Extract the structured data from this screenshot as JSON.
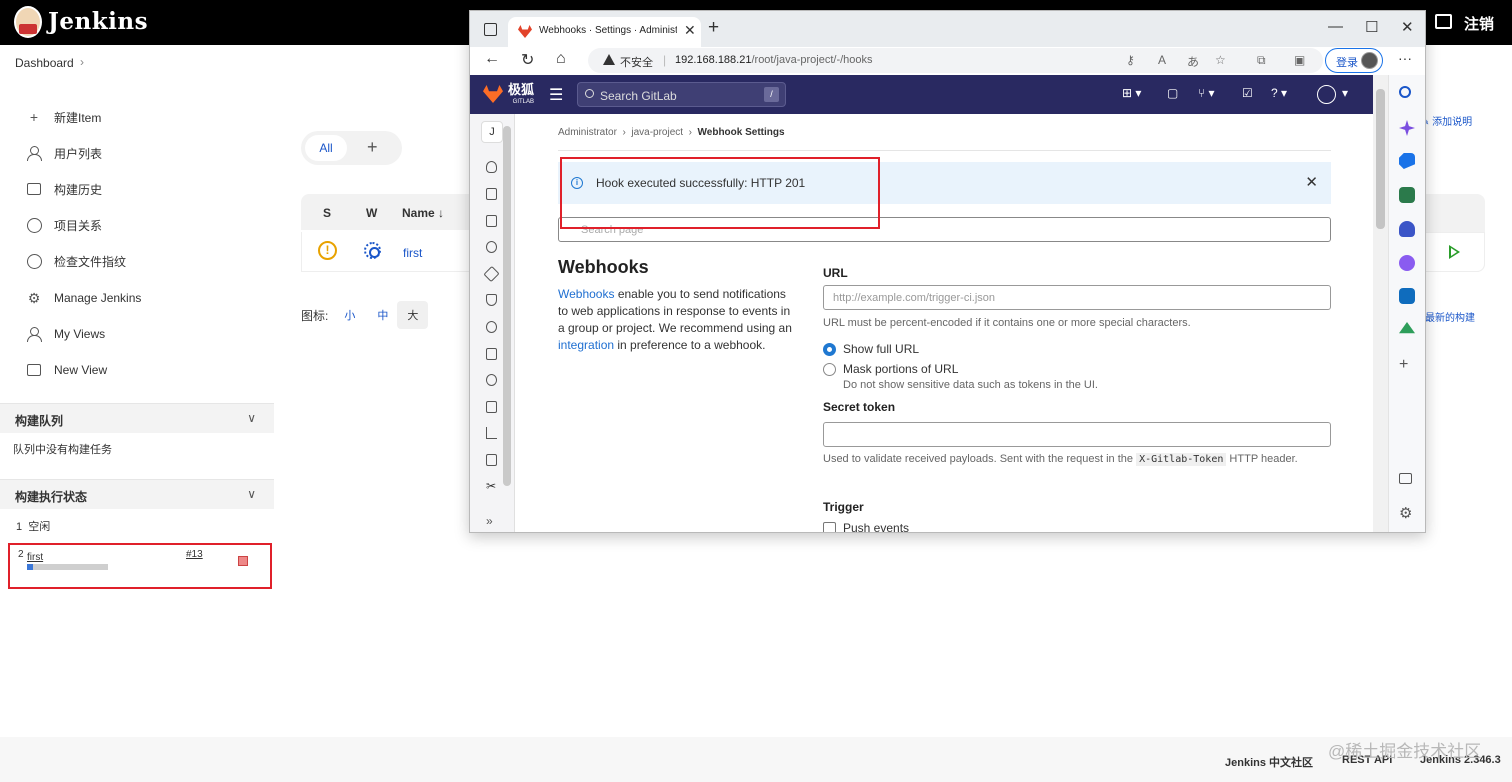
{
  "jenkins": {
    "title": "Jenkins",
    "logout": "注销",
    "breadcrumb": "Dashboard",
    "menu": [
      "新建Item",
      "用户列表",
      "构建历史",
      "项目关系",
      "检查文件指纹",
      "Manage Jenkins",
      "My Views",
      "New View"
    ],
    "queue": {
      "title": "构建队列",
      "empty": "队列中没有构建任务"
    },
    "executors": {
      "title": "构建执行状态",
      "rows": [
        {
          "num": "1",
          "status": "空闲"
        },
        {
          "num": "2",
          "job": "first",
          "build": "#13",
          "progress": 0.08
        }
      ]
    },
    "view_tabs": {
      "all": "All",
      "add": "+"
    },
    "table": {
      "headers": [
        "S",
        "W",
        "Name ↓"
      ],
      "row_name": "first"
    },
    "icon_sizes": {
      "label": "图标:",
      "small": "小",
      "medium": "中",
      "large": "大"
    },
    "right_links": {
      "add_desc": "添加说明",
      "latest_build": "最新的构建"
    },
    "footer": {
      "community": "Jenkins 中文社区",
      "rest": "REST API",
      "version": "Jenkins 2.346.3"
    },
    "watermark": "@稀土掘金技术社区"
  },
  "browser": {
    "tab_title": "Webhooks · Settings · Administrator",
    "insecure": "不安全",
    "url_host": "192.168.188.21",
    "url_path": "/root/java-project/-/hooks",
    "login": "登录"
  },
  "gitlab": {
    "brand": "极狐",
    "brand_sub": "GITLAB",
    "search_placeholder": "Search GitLab",
    "search_key": "/",
    "project_initial": "J",
    "breadcrumb": [
      "Administrator",
      "java-project",
      "Webhook Settings"
    ],
    "alert": "Hook executed successfully: HTTP 201",
    "search_page": "Search page",
    "heading": "Webhooks",
    "desc_link1": "Webhooks",
    "desc_mid": " enable you to send notifications to web applications in response to events in a group or project. We recommend using an ",
    "desc_link2": "integration",
    "desc_end": " in preference to a webhook.",
    "url_label": "URL",
    "url_placeholder": "http://example.com/trigger-ci.json",
    "url_help": "URL must be percent-encoded if it contains one or more special characters.",
    "opt_full": "Show full URL",
    "opt_mask": "Mask portions of URL",
    "opt_mask_help": "Do not show sensitive data such as tokens in the UI.",
    "token_label": "Secret token",
    "token_help_pre": "Used to validate received payloads. Sent with the request in the ",
    "token_help_code": "X-Gitlab-Token",
    "token_help_post": " HTTP header.",
    "trigger_label": "Trigger",
    "push_events": "Push events"
  }
}
